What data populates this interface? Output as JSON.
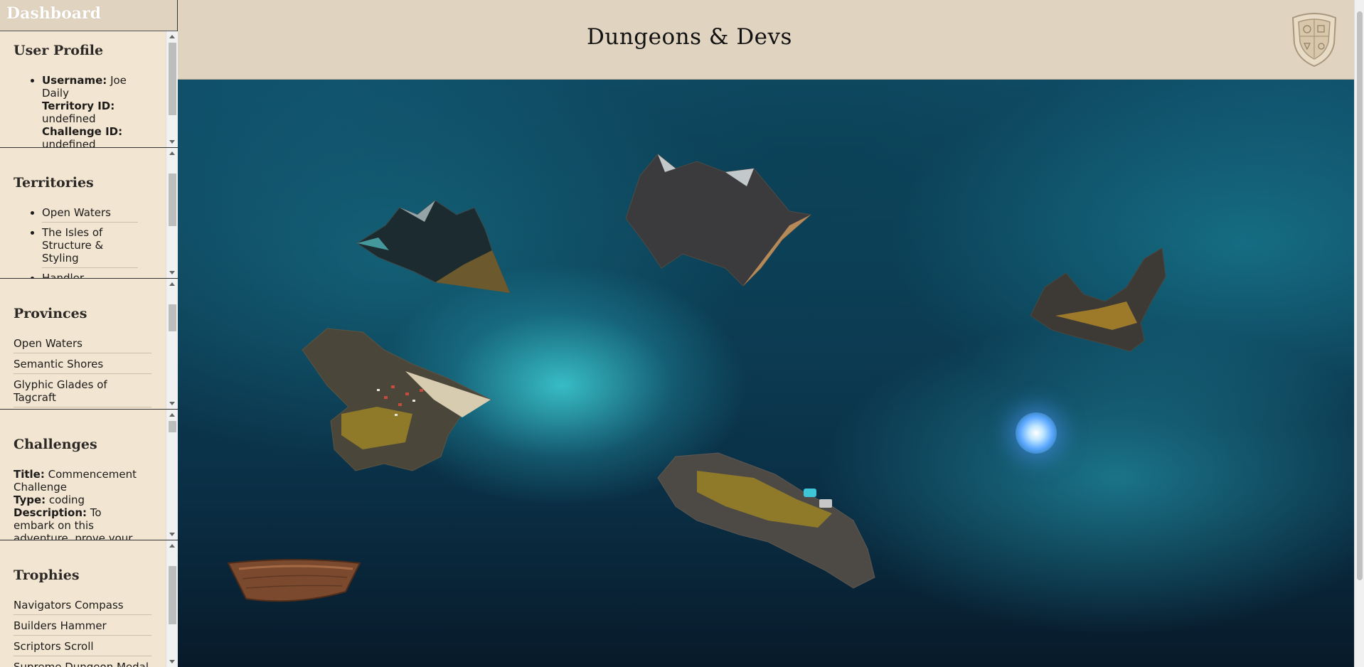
{
  "sidebar": {
    "title": "Dashboard",
    "user_profile": {
      "heading": "User Profile",
      "username_label": "Username:",
      "username": "Joe Daily",
      "territory_label": "Territory ID:",
      "territory_value": "undefined",
      "challenge_label": "Challenge ID:",
      "challenge_value": "undefined"
    },
    "territories": {
      "heading": "Territories",
      "items": [
        "Open Waters",
        "The Isles of Structure & Styling",
        "Handler Highlands"
      ]
    },
    "provinces": {
      "heading": "Provinces",
      "items": [
        "Open Waters",
        "Semantic Shores",
        "Glyphic Glades of Tagcraft"
      ]
    },
    "challenges": {
      "heading": "Challenges",
      "title_label": "Title:",
      "title_value": "Commencement Challenge",
      "type_label": "Type:",
      "type_value": "coding",
      "description_label": "Description:",
      "description_value": "To embark on this adventure, prove your coding mettle by creating"
    },
    "trophies": {
      "heading": "Trophies",
      "items": [
        "Navigators Compass",
        "Builders Hammer",
        "Scriptors Scroll",
        "Supreme Dungeon Medal"
      ]
    }
  },
  "header": {
    "title": "Dungeons & Devs",
    "crest_icon": "crest-icon"
  },
  "map": {
    "description_icons": [
      "island",
      "boat-icon",
      "glowing-orb-icon"
    ]
  },
  "colors": {
    "sidebar_bg": "#f2e6d3",
    "header_bg": "#e0d3c0",
    "ocean_deep": "#0a2f45",
    "ocean_bright": "#46e6eb"
  }
}
